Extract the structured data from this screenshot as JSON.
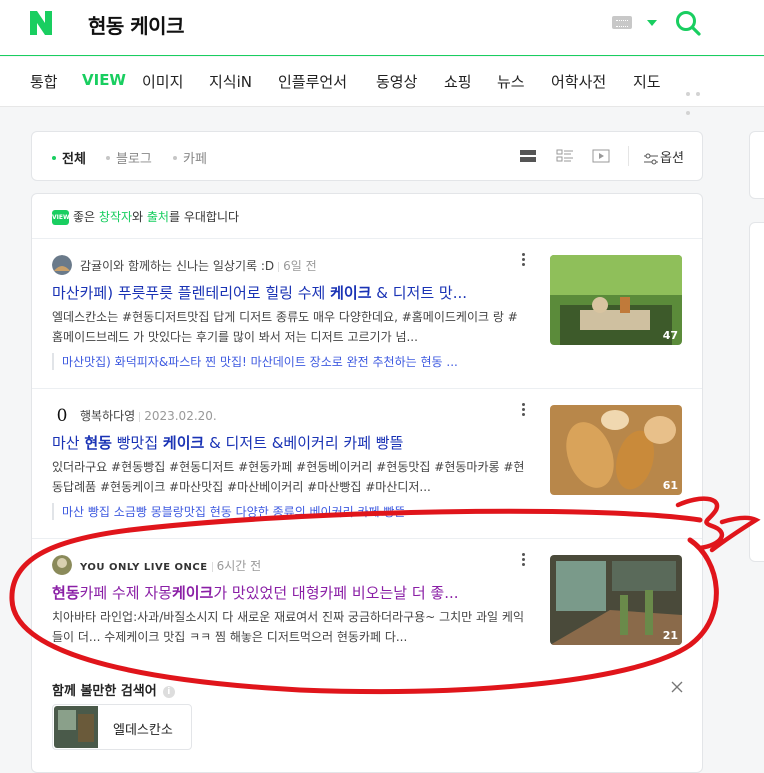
{
  "header": {
    "logo": "N",
    "query": "현동 케이크"
  },
  "tabs": [
    "통합",
    "VIEW",
    "이미지",
    "지식iN",
    "인플루언서",
    "동영상",
    "쇼핑",
    "뉴스",
    "어학사전",
    "지도"
  ],
  "active_tab": "VIEW",
  "filters": {
    "items": [
      "전체",
      "블로그",
      "카페"
    ],
    "active": "전체",
    "options_label": "옵션"
  },
  "banner": {
    "badge": "VIEW",
    "pre": "좋은 ",
    "creator": "창작자",
    "mid": "와 ",
    "source": "출처",
    "post": "를 우대합니다"
  },
  "results": [
    {
      "author": "감귤이와 함께하는 신나는 일상기록 :D",
      "date": "6일 전",
      "title_parts": [
        "마산카페) 푸릇푸릇 플렌테리어로 힐링 수제",
        "케이크",
        " & 디저트 맛..."
      ],
      "desc": "엘데스칸소는 #현동디저트맛집 답게 디저트 종류도 매우 다양한데요, #홈메이드케이크 랑 #홈메이드브레드 가 맛있다는 후기를 많이 봐서 저는 디저트 고르기가 넘...",
      "sub": "마산맛집) 화덕피자&파스타 찐 맛집! 마산데이트 장소로 완전 추천하는 현동 ...",
      "count": "47",
      "colors": [
        "#5b8b3a",
        "#9cc46a",
        "#c9b08a"
      ]
    },
    {
      "author": "행복하다영",
      "date": "2023.02.20.",
      "title_parts": [
        "마산 ",
        "현동",
        " 빵맛집 ",
        "케이크",
        " & 디저트 &베이커리 카페 빵뜰"
      ],
      "desc": "있더라구요 #현동빵집 #현동디저트 #현동카페 #현동베이커리 #현동맛집 #현동마카롱 #현동답례품 #현동케이크 #마산맛집 #마산베이커리 #마산빵집 #마산디저...",
      "sub": "마산 빵집 소금빵 몽블랑맛집 현동 다양한 종류의 베이커리 카페 빵뜰",
      "count": "61",
      "colors": [
        "#c98a3a",
        "#e3b06a",
        "#8a5a2a"
      ]
    },
    {
      "author": "YOU ONLY LIVE ONCE",
      "date": "6시간 전",
      "title_parts": [
        "현동",
        "카페 수제 자몽",
        "케이크",
        "가 맛있었던 대형카페 비오는날 더 좋..."
      ],
      "desc": "치아바타 라인업:사과/바질소시지 다 새로운 재료여서 진짜 궁금하더라구용~ 그치만 과일 케익들이 더... 수제케이크 맛집 ㅋㅋ 찜 해놓은 디저트먹으러 현동카페 다...",
      "sub": "",
      "count": "21",
      "colors": [
        "#3d4a3a",
        "#7a8a6a",
        "#b8a888"
      ]
    }
  ],
  "related": {
    "title": "함께 볼만한 검색어",
    "chip": "엘데스칸소"
  },
  "annotation": {
    "text": "3",
    "color": "#e0151b"
  }
}
